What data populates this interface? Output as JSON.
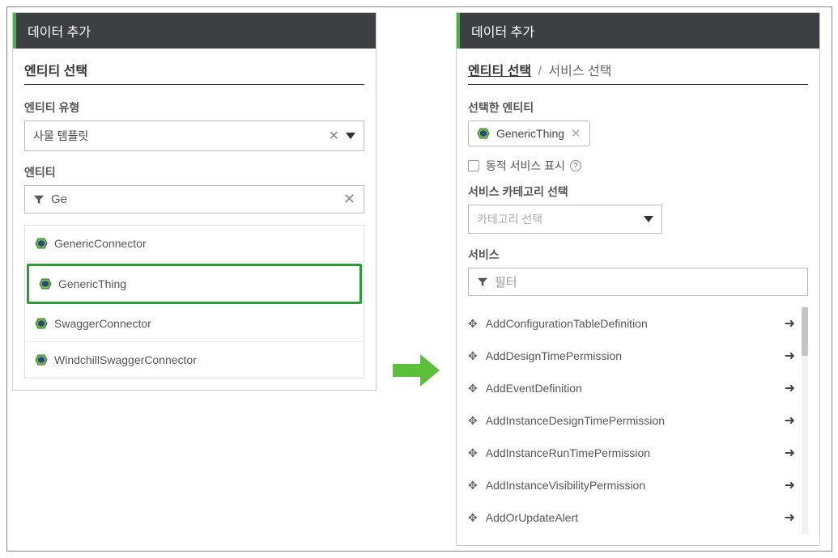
{
  "left": {
    "header": "데이터 추가",
    "section_title": "엔티티 선택",
    "entity_type_label": "엔티티 유형",
    "entity_type_value": "사물 템플릿",
    "entity_label": "엔티티",
    "filter_value": "Ge",
    "items": [
      "GenericConnector",
      "GenericThing",
      "SwaggerConnector",
      "WindchillSwaggerConnector"
    ]
  },
  "right": {
    "header": "데이터 추가",
    "breadcrumb_link": "엔티티 선택",
    "breadcrumb_current": "서비스 선택",
    "selected_entity_label": "선택한 엔티티",
    "selected_entity_value": "GenericThing",
    "dynamic_services_label": "동적 서비스 표시",
    "category_label": "서비스 카테고리 선택",
    "category_placeholder": "카테고리 선택",
    "services_label": "서비스",
    "filter_placeholder": "필터",
    "services": [
      "AddConfigurationTableDefinition",
      "AddDesignTimePermission",
      "AddEventDefinition",
      "AddInstanceDesignTimePermission",
      "AddInstanceRunTimePermission",
      "AddInstanceVisibilityPermission",
      "AddOrUpdateAlert"
    ]
  }
}
